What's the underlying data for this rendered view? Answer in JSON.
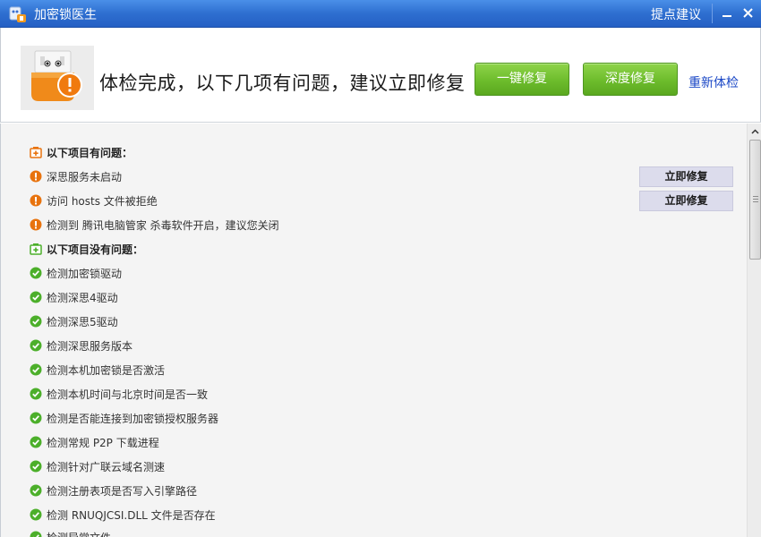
{
  "window": {
    "title": "加密锁医生",
    "suggest_label": "提点建议",
    "min_icon": "minimize-icon",
    "close_icon": "close-icon"
  },
  "header": {
    "headline": "体检完成，以下几项有问题，建议立即修复",
    "quick_fix_label": "一键修复",
    "deep_fix_label": "深度修复",
    "recheck_label": "重新体检"
  },
  "problems": {
    "heading": "以下项目有问题：",
    "items": [
      {
        "text": "深思服务未启动",
        "fix_label": "立即修复"
      },
      {
        "text": "访问 hosts 文件被拒绝",
        "fix_label": "立即修复"
      },
      {
        "text": "检测到 腾讯电脑管家 杀毒软件开启，建议您关闭"
      }
    ]
  },
  "ok": {
    "heading": "以下项目没有问题：",
    "items": [
      "检测加密锁驱动",
      "检测深思4驱动",
      "检测深思5驱动",
      "检测深思服务版本",
      "检测本机加密锁是否激活",
      "检测本机时间与北京时间是否一致",
      "检测是否能连接到加密锁授权服务器",
      "检测常规 P2P 下载进程",
      "检测针对广联云域名测速",
      "检测注册表项是否写入引擎路径",
      "检测 RNUQJCSI.DLL 文件是否存在",
      "检测异常文件"
    ]
  },
  "colors": {
    "titlebar": "#2e6fd0",
    "accent_green": "#6dbc2c",
    "warning_orange": "#e8730e",
    "ok_green": "#4caf2a",
    "link_blue": "#1a47c6"
  }
}
